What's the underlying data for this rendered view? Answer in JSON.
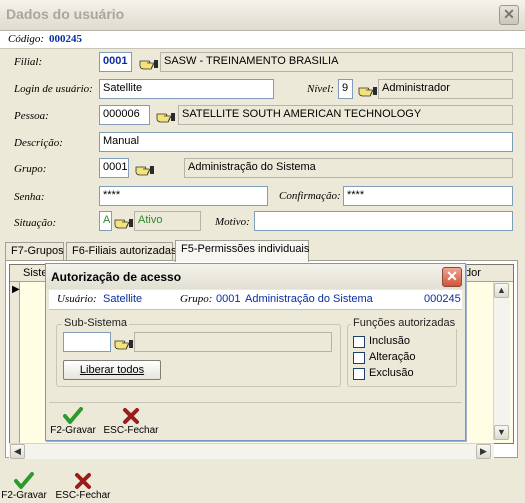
{
  "window": {
    "title": "Dados do usuário"
  },
  "code": {
    "label": "Código:",
    "value": "000245"
  },
  "form": {
    "filial": {
      "label": "Filial:",
      "code": "0001",
      "name": "SASW - TREINAMENTO BRASILIA"
    },
    "login": {
      "label": "Login de usuário:",
      "value": "Satellite"
    },
    "nivel": {
      "label": "Nível:",
      "value": "9",
      "name": "Administrador"
    },
    "pessoa": {
      "label": "Pessoa:",
      "code": "000006",
      "name": "SATELLITE SOUTH AMERICAN TECHNOLOGY"
    },
    "descricao": {
      "label": "Descrição:",
      "value": "Manual"
    },
    "grupo": {
      "label": "Grupo:",
      "code": "0001",
      "name": "Administração do Sistema"
    },
    "senha": {
      "label": "Senha:",
      "value": "****"
    },
    "confirmacao": {
      "label": "Confirmação:",
      "value": "****"
    },
    "situacao": {
      "label": "Situação:",
      "code": "A",
      "name": "Ativo"
    },
    "motivo": {
      "label": "Motivo:",
      "value": ""
    }
  },
  "tabs": [
    {
      "label": "F7-Grupos"
    },
    {
      "label": "F6-Filiais autorizadas"
    },
    {
      "label": "F5-Permissões individuais"
    }
  ],
  "grid": {
    "col_left": "Siste",
    "col_right": "dor"
  },
  "dialog": {
    "title": "Autorização de acesso",
    "usuario_label": "Usuário:",
    "usuario_value": "Satellite",
    "grupo_label": "Grupo:",
    "grupo_code": "0001",
    "grupo_name": "Administração do Sistema",
    "code": "000245",
    "subsistema": {
      "legend": "Sub-Sistema",
      "code": "",
      "name": ""
    },
    "liberar_label": "Liberar todos",
    "funcoes": {
      "legend": "Funções autorizadas",
      "items": [
        {
          "label": "Inclusão",
          "checked": false
        },
        {
          "label": "Alteração",
          "checked": false
        },
        {
          "label": "Exclusão",
          "checked": false
        }
      ]
    },
    "save_label": "F2-Gravar",
    "close_label": "ESC-Fechar"
  },
  "footer": {
    "save_label": "F2-Gravar",
    "close_label": "ESC-Fechar"
  },
  "colors": {
    "accent_blue": "#0b2ea0",
    "status_green": "#2f8a2f",
    "dialog_border": "#7a97c8"
  }
}
